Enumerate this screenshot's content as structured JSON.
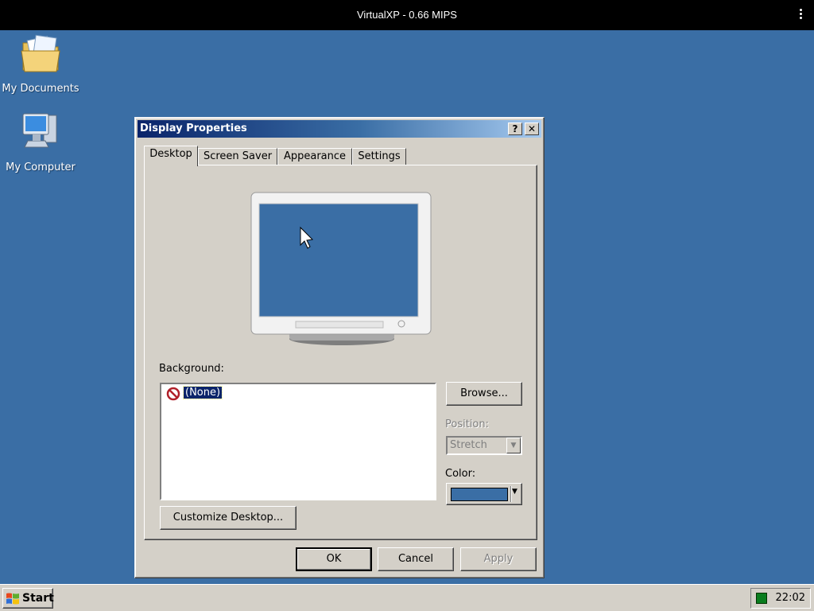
{
  "host": {
    "title": "VirtualXP - 0.66 MIPS"
  },
  "desktop": {
    "background_color": "#3a6ea5",
    "icons": [
      {
        "label": "My Documents",
        "icon": "folder-documents-icon"
      },
      {
        "label": "My Computer",
        "icon": "computer-icon"
      }
    ]
  },
  "dialog": {
    "title": "Display Properties",
    "help_button": "?",
    "close_button": "✕",
    "tabs": [
      {
        "label": "Desktop",
        "active": true
      },
      {
        "label": "Screen Saver",
        "active": false
      },
      {
        "label": "Appearance",
        "active": false
      },
      {
        "label": "Settings",
        "active": false
      }
    ],
    "background_label": "Background:",
    "background_items": [
      {
        "label": "(None)",
        "selected": true,
        "icon": "none-icon"
      }
    ],
    "browse_label": "Browse...",
    "position_label": "Position:",
    "position_value": "Stretch",
    "color_label": "Color:",
    "color_value": "#3a6ea5",
    "customize_label": "Customize Desktop...",
    "ok_label": "OK",
    "cancel_label": "Cancel",
    "apply_label": "Apply"
  },
  "taskbar": {
    "start_label": "Start",
    "clock": "22:02"
  }
}
